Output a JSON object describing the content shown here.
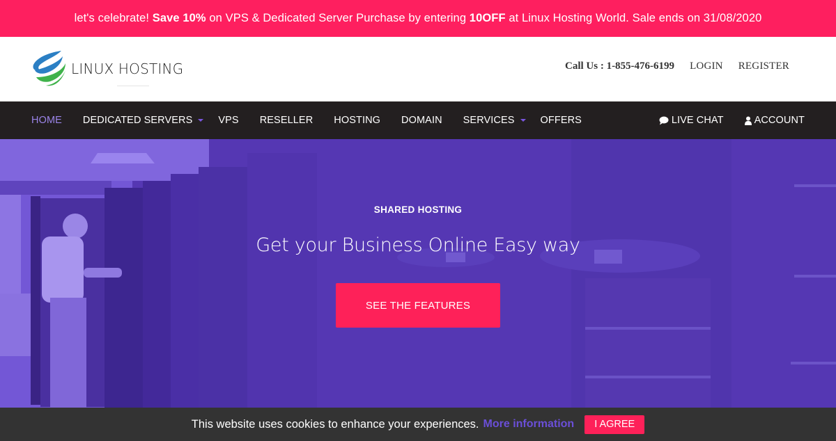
{
  "promo": {
    "prefix": "let's celebrate! ",
    "save_bold": "Save 10%",
    "middle": " on VPS & Dedicated Server Purchase by entering ",
    "code_bold": "10OFF",
    "suffix": " at Linux Hosting World. Sale ends on 31/08/2020"
  },
  "header": {
    "logo_text": "LINUX HOSTING",
    "call_us": "Call Us : 1-855-476-6199",
    "login": "LOGIN",
    "register": "REGISTER"
  },
  "nav": {
    "items": [
      {
        "label": "HOME",
        "active": true,
        "dropdown": false
      },
      {
        "label": "DEDICATED SERVERS",
        "active": false,
        "dropdown": true
      },
      {
        "label": "VPS",
        "active": false,
        "dropdown": false
      },
      {
        "label": "RESELLER",
        "active": false,
        "dropdown": false
      },
      {
        "label": "HOSTING",
        "active": false,
        "dropdown": false
      },
      {
        "label": "DOMAIN",
        "active": false,
        "dropdown": false
      },
      {
        "label": "SERVICES",
        "active": false,
        "dropdown": true
      },
      {
        "label": "OFFERS",
        "active": false,
        "dropdown": false
      }
    ],
    "live_chat": "LIVE CHAT",
    "live_chat_icon": "comment-icon",
    "account": "ACCOUNT",
    "account_icon": "user-icon"
  },
  "hero": {
    "subtitle": "SHARED HOSTING",
    "title": "Get your Business Online Easy way",
    "button": "SEE THE FEATURES",
    "background_image": "server-room-photo"
  },
  "cookie": {
    "text": "This website uses cookies to enhance your experiences.",
    "link": "More information",
    "button": "I AGREE"
  },
  "colors": {
    "accent_pink": "#fe1f5f",
    "nav_bg": "#231f20",
    "nav_active": "#9b84e8",
    "hero_overlay": "#5638b5",
    "cookie_link": "#6b4fd8"
  }
}
